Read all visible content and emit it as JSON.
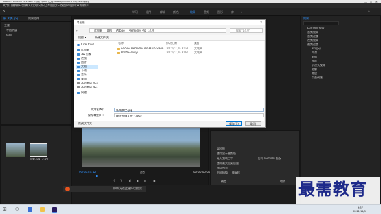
{
  "app_title": "Adobe Premiere Pro 2020 - C:\\用户\\hbuy\\文档\\Adobe\\Premiere Pro\\14.0\\未命名 *",
  "menu": [
    "文件(F)",
    "编辑(E)",
    "剪辑(C)",
    "序列(S)",
    "标记(M)",
    "图形(G)",
    "视图(V)",
    "窗口(W)",
    "帮助(H)"
  ],
  "workspaces": [
    "学习",
    "组件",
    "编辑",
    "颜色",
    "效果",
    "音频",
    "图形",
    "库",
    "»"
  ],
  "active_workspace": "效果",
  "source_panel": {
    "tab": "源: 大美.jpg",
    "tab2": "效果控件",
    "items": [
      "主要",
      "不透明度",
      "运动"
    ]
  },
  "dialog": {
    "title": "导出帧",
    "address": [
      "此电脑",
      "文档",
      "Adobe",
      "Premiere Pro",
      "14.0"
    ],
    "search_placeholder": "搜索\"14.0\"",
    "toolbar": {
      "organize": "组织 ▾",
      "new_folder": "新建文件夹"
    },
    "nav": [
      "OneDrive",
      "此电脑",
      "3D 对象",
      "视频",
      "图片",
      "文档",
      "下载",
      "音乐",
      "桌面",
      "本地磁盘 (C:)",
      "本地磁盘 (D:)",
      "网络"
    ],
    "columns": {
      "name": "名称",
      "date": "修改日期",
      "type": "类型"
    },
    "files": [
      {
        "name": "Adobe Premiere Pro Auto-Save",
        "date": "2021/11/5 8:19",
        "type": "文件夹"
      },
      {
        "name": "Profile-hbuy",
        "date": "2021/11/5 8:43",
        "type": "文件夹"
      }
    ],
    "filename_label": "文件名(N):",
    "filename_value": "新城景色.jpg",
    "savetype_label": "保存类型(T):",
    "savetype_value": "静止图像文件(*.jpg)",
    "hide_folders": "隐藏文件夹",
    "save_button": "保存(S)",
    "cancel_button": "取消"
  },
  "right_panel": {
    "tab": "效果",
    "tree": [
      "Lumetri 预设",
      "音频效果",
      "音频过渡",
      "视频效果",
      "视频过渡",
      "3D运动",
      "内滑",
      "划像",
      "擦除",
      "沉浸式视频",
      "溶解",
      "缩放",
      "页面剥落"
    ]
  },
  "export_panel": {
    "options": [
      "导出帧",
      "使用显示器颜色",
      "导入到项目中",
      "使用最大渲染质量",
      "使用预览",
      "设置开始时间码"
    ],
    "option_right": "打开 Lumetri 面板",
    "field_label": "时间插值:",
    "field_value": "帧采样",
    "ok": "确定",
    "cancel": "取消"
  },
  "timecodes": {
    "left": "00:00:03:12",
    "right": "00:00:05:00"
  },
  "fit_label": "适合",
  "project_items": [
    {
      "name": "大美.jpg",
      "dur": "5:00"
    }
  ],
  "input_bar": {
    "label": "中文/英",
    "hint": "在此键入以搜索"
  },
  "taskbar": {
    "time": "9:37",
    "date": "2021/11/5"
  },
  "watermark": "最需教育"
}
